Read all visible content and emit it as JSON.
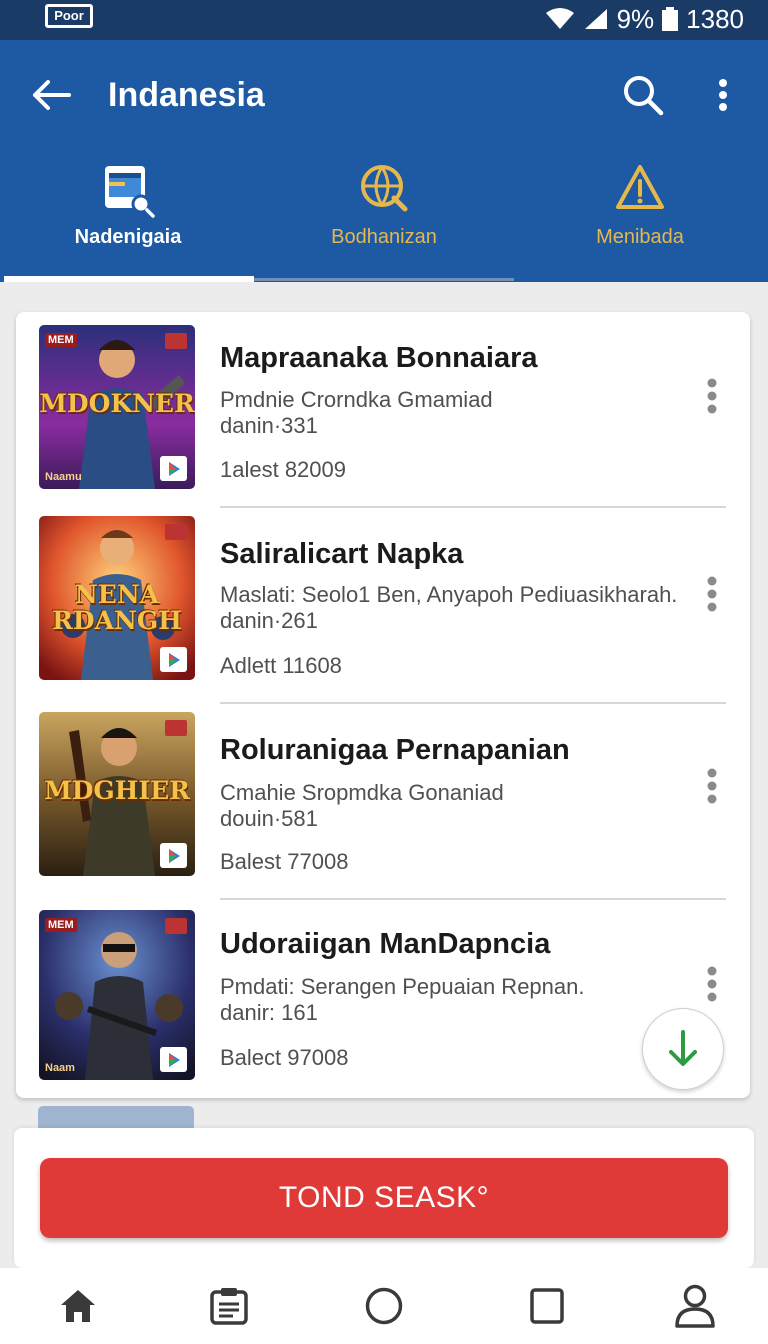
{
  "status_bar": {
    "carrier_logo": "Poor",
    "battery": "9%",
    "time": "1380"
  },
  "app_bar": {
    "title": "Indanesia",
    "back_icon": "arrow-left-icon",
    "search_icon": "search-icon",
    "more_icon": "more-vertical-icon"
  },
  "tabs": [
    {
      "label": "Nadenigaia",
      "icon": "tablet-search-icon",
      "active": true
    },
    {
      "label": "Bodhanizan",
      "icon": "globe-search-icon",
      "active": false
    },
    {
      "label": "Menibada",
      "icon": "warning-icon",
      "active": false
    }
  ],
  "items": [
    {
      "title": "Mapraanaka Bonnaiara",
      "subtitle": "Pmdnie Crorndka Gmamiad",
      "detail": "danin·331",
      "meta": "1alest 82009",
      "thumb_badge": "MEM",
      "thumb_word": "MDOKNER",
      "thumb_footer": "Naamu"
    },
    {
      "title": "Saliralicart Napka",
      "subtitle": "Maslati: Seolo1 Ben, Anyapoh Pediuasikharah.",
      "detail": "danin·261",
      "meta": "Adlett 11608",
      "thumb_badge": "",
      "thumb_word": "NENA RDANGH",
      "thumb_footer": ""
    },
    {
      "title": "Roluranigaa Pernapanian",
      "subtitle": "Cmahie Sropmdka Gonaniad",
      "detail": "douin·581",
      "meta": "Balest 77008",
      "thumb_badge": "",
      "thumb_word": "MDGHIER",
      "thumb_footer": ""
    },
    {
      "title": "Udoraiigan ManDapncia",
      "subtitle": "Pmdati: Serangen Pepuaian Repnan.",
      "detail": "danir: 161",
      "meta": "Balect 97008",
      "thumb_badge": "MEM",
      "thumb_word": "",
      "thumb_footer": "Naam"
    }
  ],
  "download_button_icon": "download-arrow-icon",
  "primary_button": {
    "label": "TOND SEASK°"
  },
  "bottom_nav": [
    {
      "name": "home",
      "icon": "home-icon"
    },
    {
      "name": "list",
      "icon": "clipboard-icon"
    },
    {
      "name": "circle",
      "icon": "circle-icon"
    },
    {
      "name": "square",
      "icon": "square-icon"
    },
    {
      "name": "profile",
      "icon": "person-icon"
    }
  ],
  "colors": {
    "status_bar": "#1a3b66",
    "app_bar": "#1d5aa3",
    "tab_accent": "#e6b84c",
    "primary_button": "#e03a38",
    "download_arrow": "#2e9a44"
  }
}
